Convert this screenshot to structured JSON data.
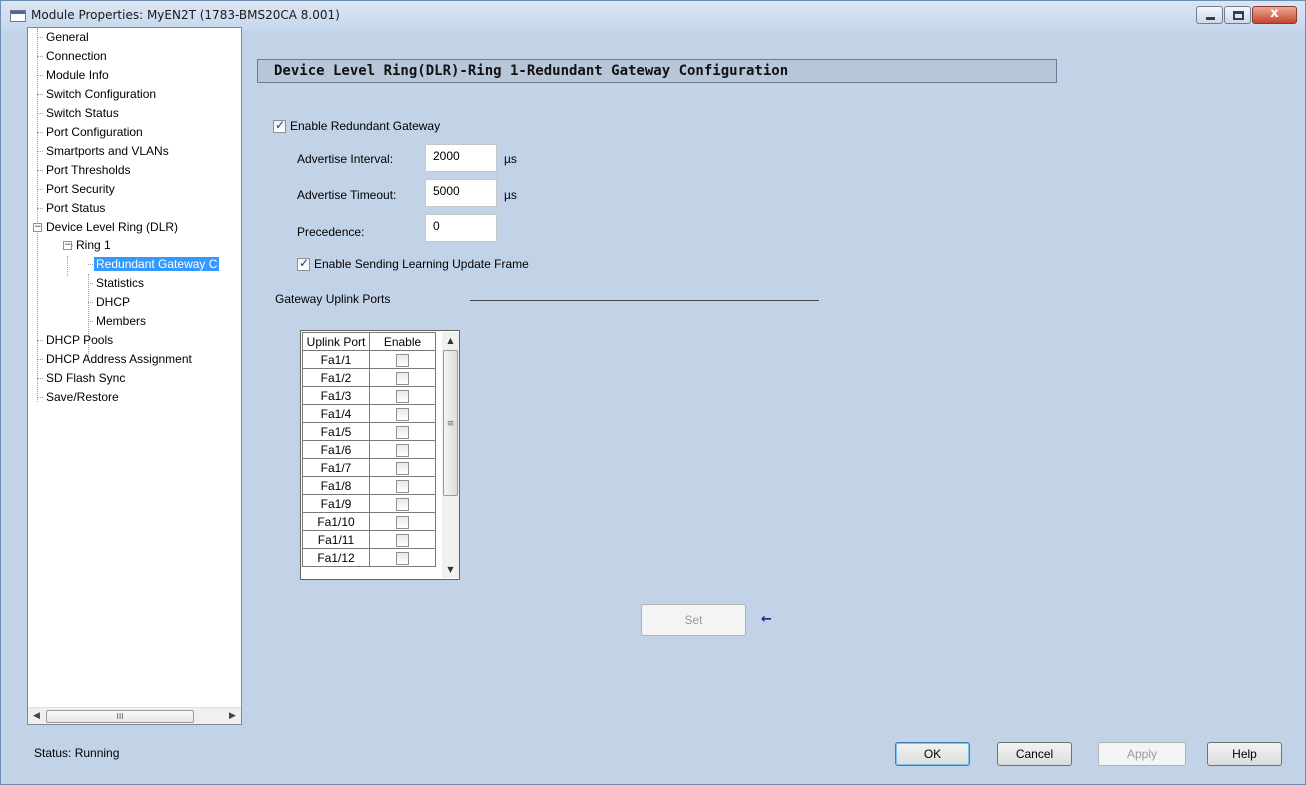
{
  "window": {
    "title": "Module Properties: MyEN2T (1783-BMS20CA 8.001)",
    "controls": {
      "minimize": "minimize",
      "maximize": "maximize",
      "close": "x"
    }
  },
  "tree": {
    "items": [
      {
        "label": "General"
      },
      {
        "label": "Connection"
      },
      {
        "label": "Module Info"
      },
      {
        "label": "Switch Configuration"
      },
      {
        "label": "Switch Status"
      },
      {
        "label": "Port Configuration"
      },
      {
        "label": "Smartports and VLANs"
      },
      {
        "label": "Port Thresholds"
      },
      {
        "label": "Port Security"
      },
      {
        "label": "Port Status"
      },
      {
        "label": "Device Level Ring (DLR)"
      },
      {
        "label": "Ring 1"
      },
      {
        "label": "Redundant Gateway C"
      },
      {
        "label": "Statistics"
      },
      {
        "label": "DHCP"
      },
      {
        "label": "Members"
      },
      {
        "label": "DHCP Pools"
      },
      {
        "label": "DHCP Address Assignment"
      },
      {
        "label": "SD Flash Sync"
      },
      {
        "label": "Save/Restore"
      }
    ],
    "scroll_thumb_grip": "III"
  },
  "panel": {
    "header": "Device Level Ring(DLR)-Ring 1-Redundant Gateway Configuration",
    "enable_gateway": {
      "label": "Enable Redundant Gateway",
      "checked": true
    },
    "advertise_interval": {
      "label": "Advertise Interval:",
      "value": "2000",
      "unit": "µs"
    },
    "advertise_timeout": {
      "label": "Advertise Timeout:",
      "value": "5000",
      "unit": "µs"
    },
    "precedence": {
      "label": "Precedence:",
      "value": "0"
    },
    "enable_learning": {
      "label": "Enable Sending Learning Update Frame",
      "checked": true
    },
    "uplink_section_label": "Gateway Uplink Ports",
    "table": {
      "headers": [
        "Uplink Port",
        "Enable"
      ],
      "rows": [
        "Fa1/1",
        "Fa1/2",
        "Fa1/3",
        "Fa1/4",
        "Fa1/5",
        "Fa1/6",
        "Fa1/7",
        "Fa1/8",
        "Fa1/9",
        "Fa1/10",
        "Fa1/11",
        "Fa1/12"
      ]
    },
    "set_button": "Set",
    "arrow_glyph": "←"
  },
  "status": {
    "text": "Status:  Running"
  },
  "buttons": {
    "ok": "OK",
    "cancel": "Cancel",
    "apply": "Apply",
    "help": "Help"
  }
}
